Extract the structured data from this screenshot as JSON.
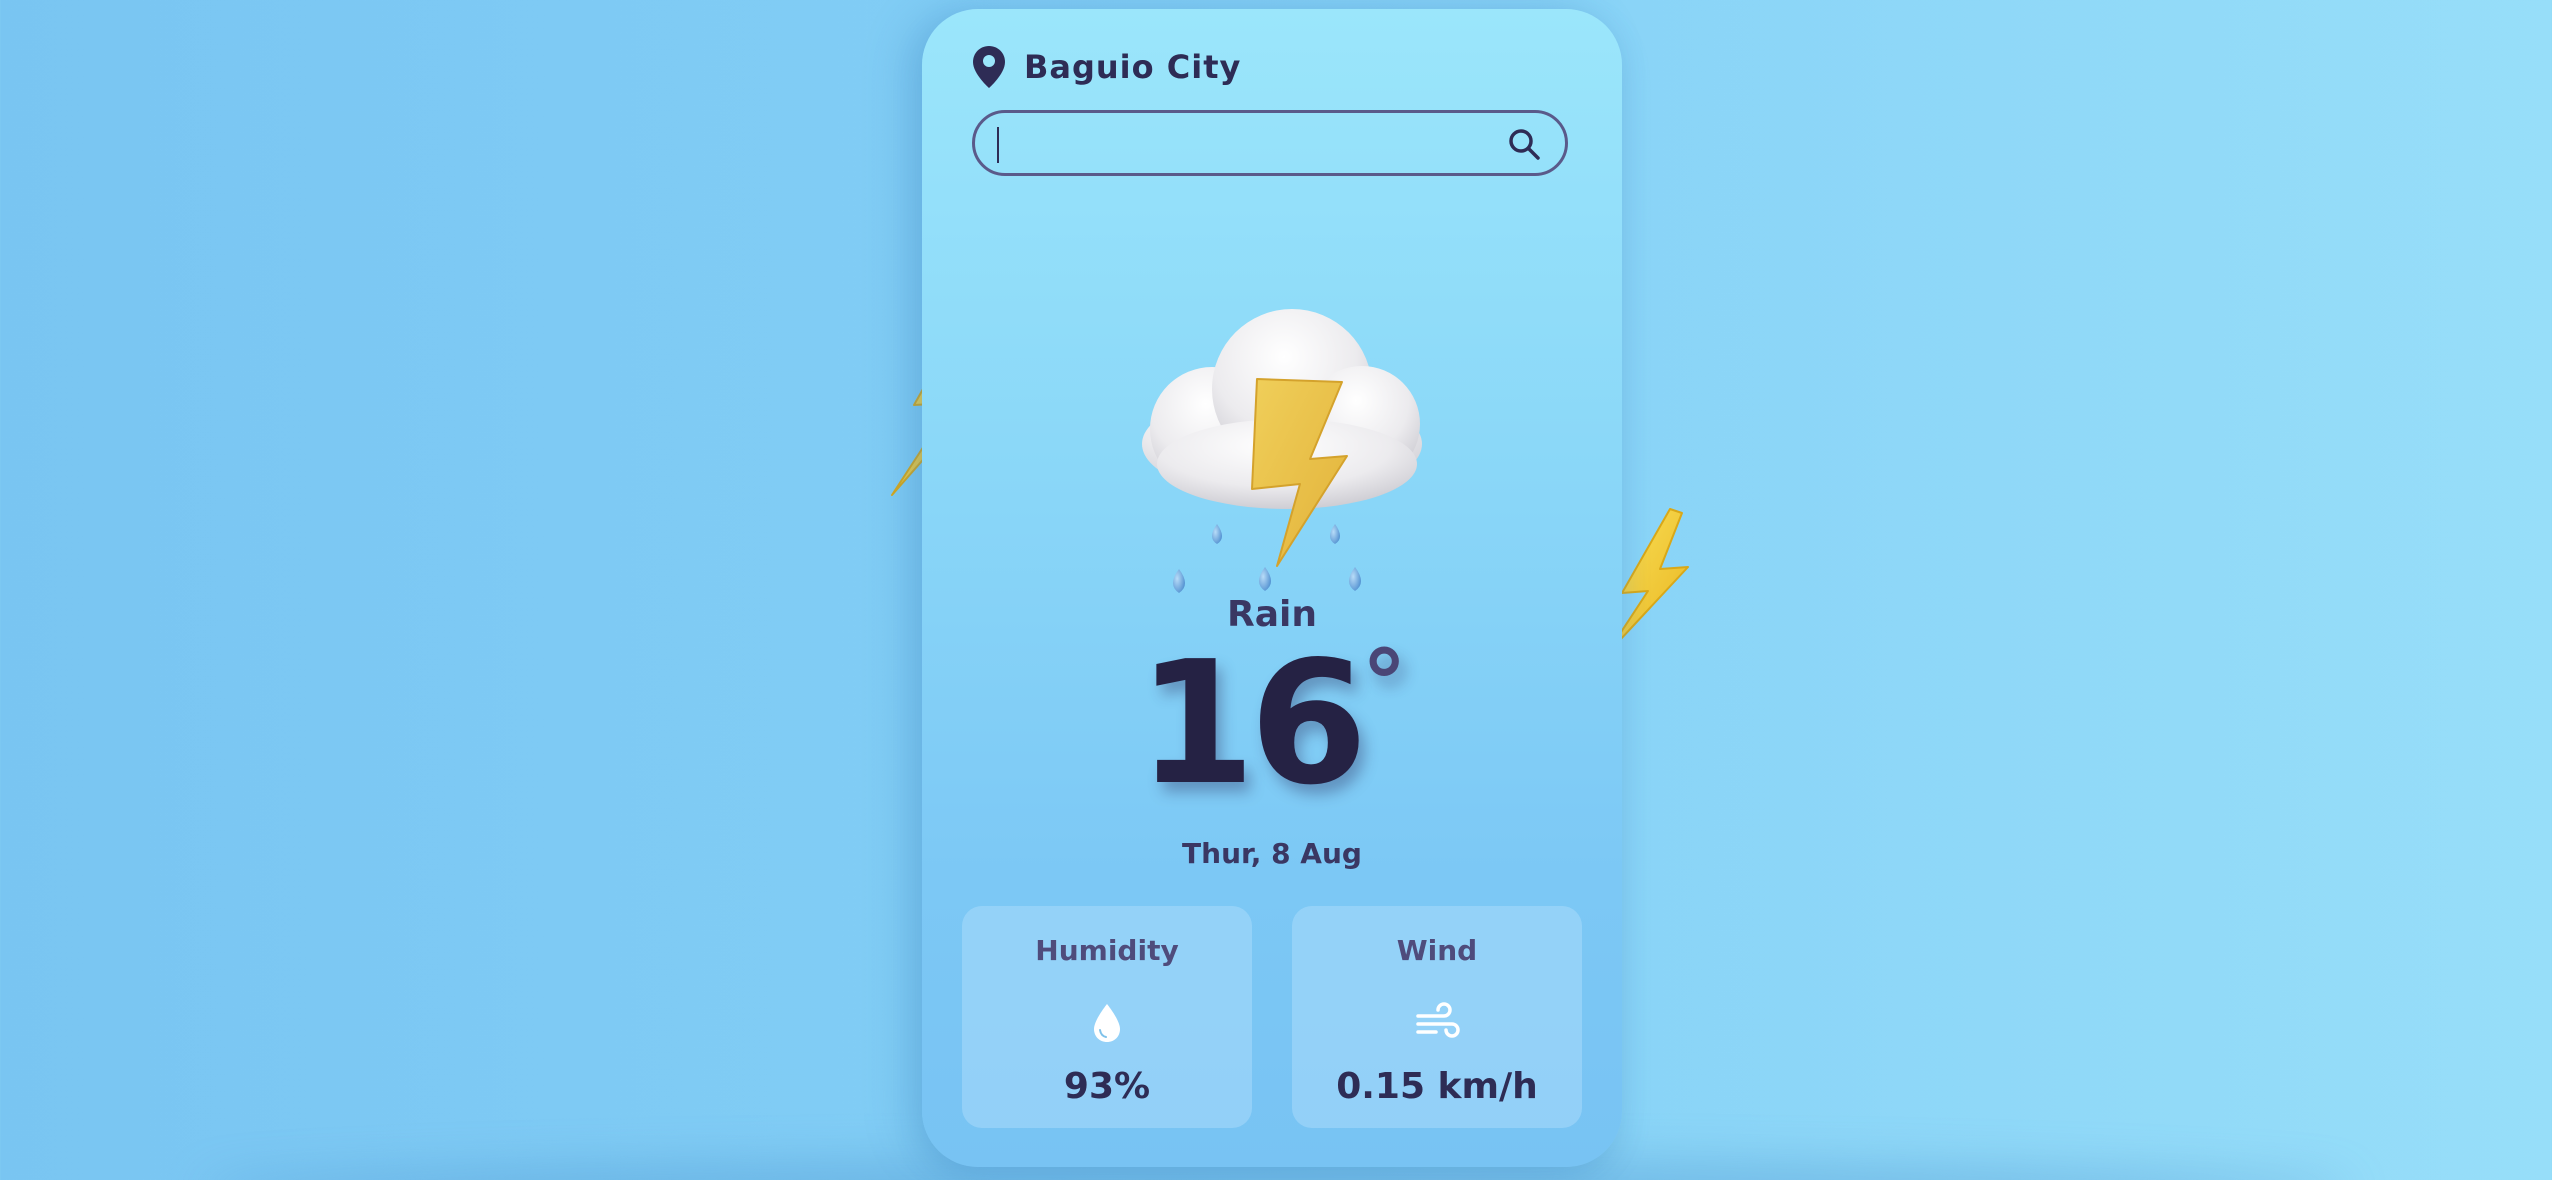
{
  "location": {
    "icon": "map-pin-icon",
    "city": "Baguio City"
  },
  "search": {
    "value": "",
    "placeholder": "",
    "icon": "search-icon"
  },
  "weather": {
    "icon": "thunderstorm-rain-icon",
    "condition": "Rain",
    "temperature": "16",
    "degree_symbol": "°",
    "date": "Thur, 8 Aug"
  },
  "stats": {
    "humidity": {
      "label": "Humidity",
      "icon": "droplet-icon",
      "value": "93%"
    },
    "wind": {
      "label": "Wind",
      "icon": "wind-icon",
      "value": "0.15 km/h"
    }
  },
  "decorations": {
    "icon": "lightning-bolt-icon"
  },
  "colors": {
    "text_primary": "#2e2c55",
    "bolt_yellow": "#f2cc2f",
    "background": "#83cff6"
  }
}
